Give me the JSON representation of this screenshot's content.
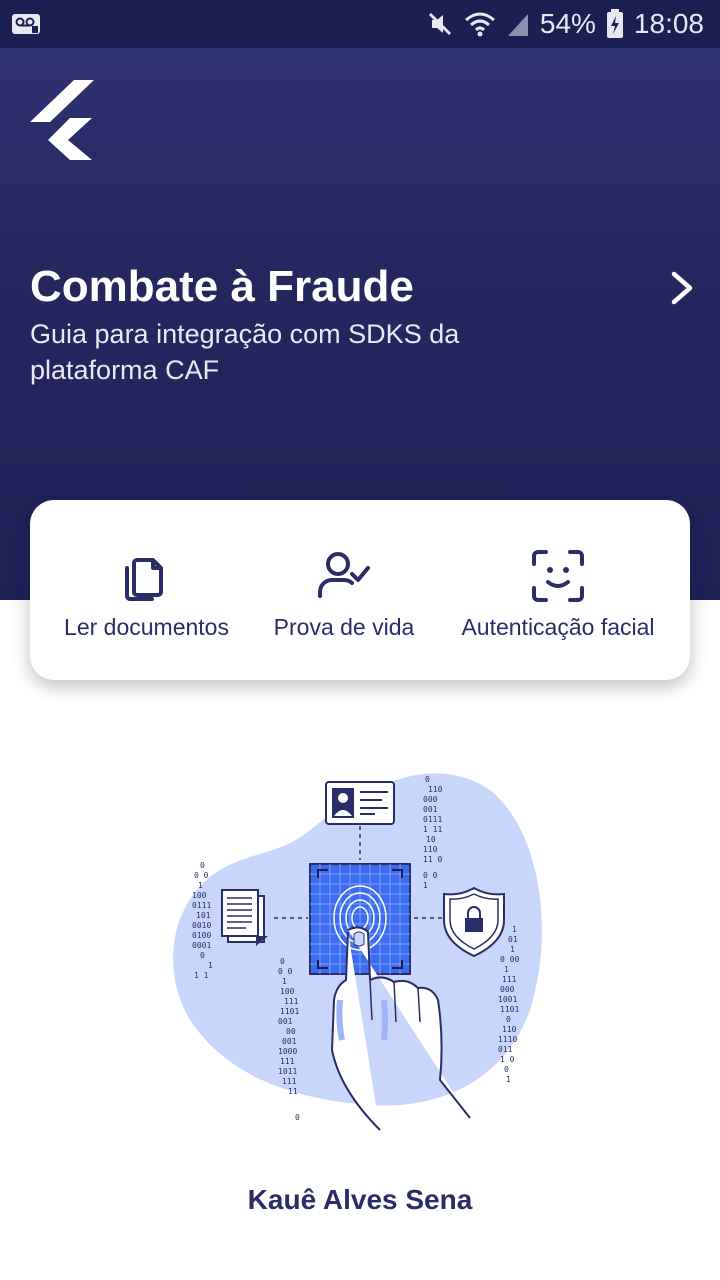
{
  "status_bar": {
    "battery": "54%",
    "time": "18:08",
    "icons": [
      "voicemail-icon",
      "mute-icon",
      "wifi-icon",
      "signal-icon",
      "battery-charging-icon"
    ]
  },
  "hero": {
    "title": "Combate à Fraude",
    "subtitle": "Guia para integração com SDKS da plataforma CAF",
    "logo": "flutter-logo",
    "arrow": "chevron-right-icon"
  },
  "actions": [
    {
      "label": "Ler documentos",
      "icon": "documents-icon"
    },
    {
      "label": "Prova de vida",
      "icon": "user-check-icon"
    },
    {
      "label": "Autenticação facial",
      "icon": "face-scan-icon"
    }
  ],
  "author": "Kauê Alves Sena",
  "colors": {
    "primary": "#2b2d68",
    "hero_bg": "#25275f",
    "status_bg": "#1c1f52",
    "blob": "#c9d6fb",
    "accent_blue": "#3b6cf0"
  }
}
